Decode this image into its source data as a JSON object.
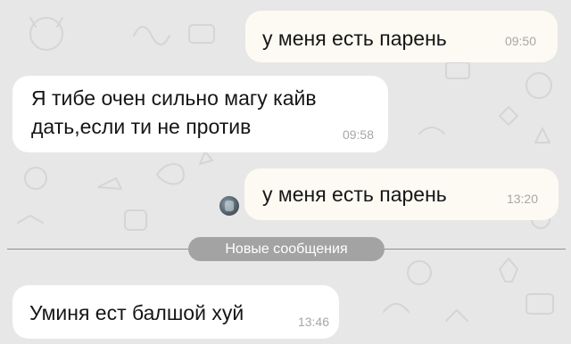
{
  "colors": {
    "chat_background": "#e7e7e7",
    "outgoing_bubble": "#fdfaf3",
    "incoming_bubble": "#ffffff",
    "timestamp": "#a7a7a7",
    "divider_pill": "#a3a3a3"
  },
  "messages": [
    {
      "direction": "outgoing",
      "text": "у меня есть парень",
      "time": "09:50"
    },
    {
      "direction": "incoming",
      "text": "Я тибе очен сильно магу кайв\nдать,если ти не против",
      "time": "09:58"
    },
    {
      "direction": "outgoing",
      "text": "у меня есть парень",
      "time": "13:20",
      "avatar": "user-avatar-icon"
    },
    {
      "direction": "incoming",
      "text": "Уминя ест балшой хуй",
      "time": "13:46"
    }
  ],
  "divider": {
    "label": "Новые сообщения"
  }
}
